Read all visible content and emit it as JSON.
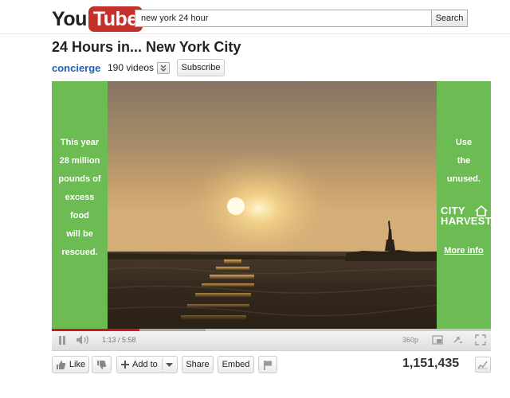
{
  "header": {
    "logo": {
      "you": "You",
      "tube": "Tube"
    },
    "search": {
      "value": "new york 24 hour",
      "button_label": "Search"
    }
  },
  "video": {
    "title": "24 Hours in... New York City",
    "channel": "concierge",
    "video_count": "190 videos",
    "subscribe_label": "Subscribe"
  },
  "ad": {
    "left_lines": [
      "This year",
      "28 million",
      "pounds of",
      "excess",
      "food",
      "will be",
      "rescued."
    ],
    "right_lines": [
      "Use",
      "the",
      "unused."
    ],
    "logo_text": [
      "CITY",
      "HARVEST"
    ],
    "more_info": "More info"
  },
  "player": {
    "time": "1:13 / 5:58",
    "quality": "360p",
    "progress_played_fraction": 0.2,
    "progress_buffered_fraction": 0.35
  },
  "actions": {
    "like": "Like",
    "add_to": "Add to",
    "share": "Share",
    "embed": "Embed"
  },
  "views": "1,151,435",
  "colors": {
    "brand_red": "#c4302b",
    "ad_green": "#6dbb53",
    "link_blue": "#1c62b9",
    "progress_red": "#cc181e"
  }
}
